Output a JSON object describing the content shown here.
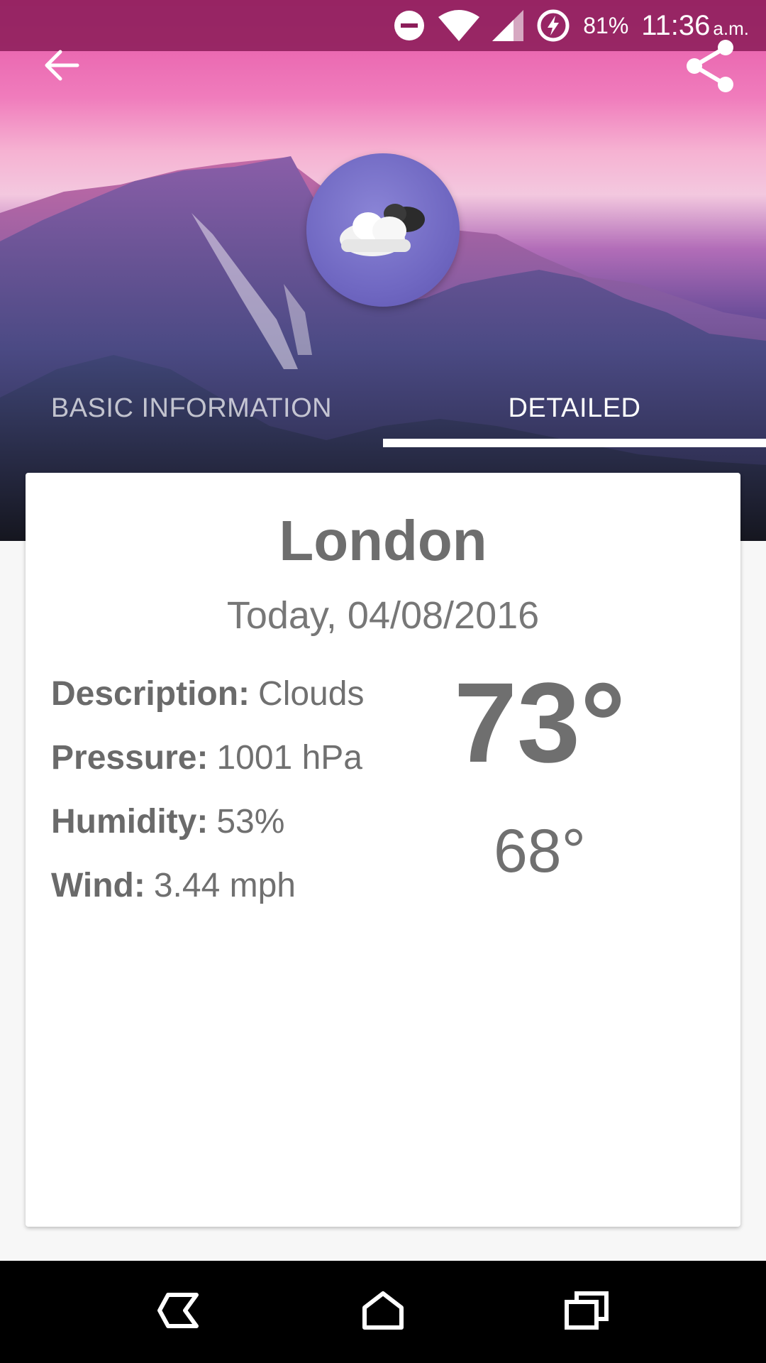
{
  "status_bar": {
    "battery_percent": "81%",
    "time": "11:36",
    "ampm": "a.m.",
    "icons": [
      "do-not-disturb-icon",
      "wifi-icon",
      "cell-signal-icon",
      "battery-charging-icon"
    ]
  },
  "app_bar": {
    "back_icon": "arrow-left-icon",
    "share_icon": "share-icon"
  },
  "weather_icon": "partly-cloudy-icon",
  "tabs": [
    {
      "label": "BASIC INFORMATION",
      "active": false
    },
    {
      "label": "DETAILED",
      "active": true
    }
  ],
  "card": {
    "city": "London",
    "date": "Today, 04/08/2016",
    "details": [
      {
        "label": "Description:",
        "value": "Clouds"
      },
      {
        "label": "Pressure:",
        "value": "1001 hPa"
      },
      {
        "label": "Humidity:",
        "value": "53%"
      },
      {
        "label": "Wind:",
        "value": "3.44 mph"
      }
    ],
    "temp_high": "73°",
    "temp_low": "68°"
  },
  "nav_bar": {
    "icons": [
      "back-nav-icon",
      "home-nav-icon",
      "recents-nav-icon"
    ]
  },
  "colors": {
    "status_bar": "#8c1e5a",
    "text_gray": "#6e6e6e",
    "circle": "#7068c2",
    "nav_bar": "#000000"
  }
}
